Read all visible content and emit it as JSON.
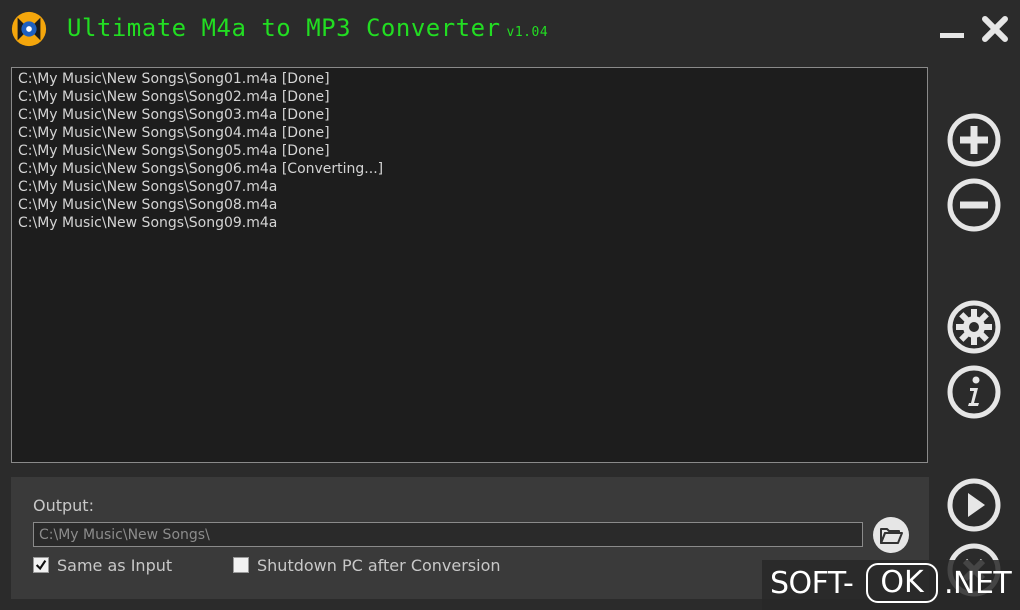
{
  "window": {
    "title": "Ultimate M4a to MP3 Converter",
    "version": "v1.04"
  },
  "file_list": [
    "C:\\My Music\\New Songs\\Song01.m4a [Done]",
    "C:\\My Music\\New Songs\\Song02.m4a [Done]",
    "C:\\My Music\\New Songs\\Song03.m4a [Done]",
    "C:\\My Music\\New Songs\\Song04.m4a [Done]",
    "C:\\My Music\\New Songs\\Song05.m4a [Done]",
    "C:\\My Music\\New Songs\\Song06.m4a [Converting...]",
    "C:\\My Music\\New Songs\\Song07.m4a",
    "C:\\My Music\\New Songs\\Song08.m4a",
    "C:\\My Music\\New Songs\\Song09.m4a"
  ],
  "sidebar": {
    "icons": [
      "plus-circle-icon",
      "minus-circle-icon",
      "gear-icon",
      "info-icon",
      "play-icon",
      "stop-icon"
    ]
  },
  "output": {
    "label": "Output:",
    "path": "C:\\My Music\\New Songs\\",
    "same_as_input": {
      "label": "Same as Input",
      "checked": true
    },
    "shutdown": {
      "label": "Shutdown PC after Conversion",
      "checked": false
    }
  },
  "watermark": {
    "left": "SOFT-",
    "middle": "OK",
    "right": ".NET"
  },
  "colors": {
    "title": "#22dd22",
    "background": "#2b2b2b",
    "list_background": "#1d1d1d",
    "icon": "#e6e6e6"
  }
}
